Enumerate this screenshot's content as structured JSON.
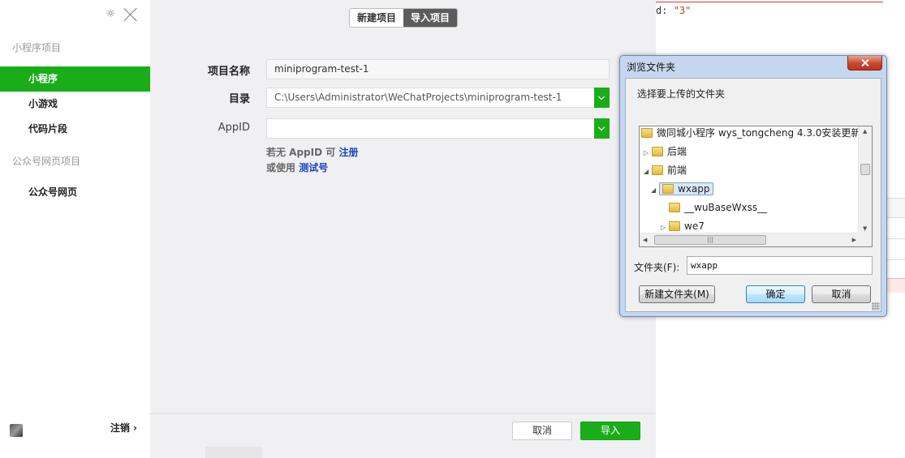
{
  "sidebar": {
    "section1_title": "小程序项目",
    "items": [
      {
        "label": "小程序",
        "active": true
      },
      {
        "label": "小游戏",
        "active": false
      },
      {
        "label": "代码片段",
        "active": false
      }
    ],
    "section2_title": "公众号网页项目",
    "item_webpage": "公众号网页",
    "logout_label": "注销 ›"
  },
  "tabs": {
    "new_project": "新建项目",
    "import_project": "导入项目"
  },
  "form": {
    "name_label": "项目名称",
    "name_value": "miniprogram-test-1",
    "dir_label": "目录",
    "dir_value": "C:\\Users\\Administrator\\WeChatProjects\\miniprogram-test-1",
    "appid_label": "AppID",
    "appid_value": "",
    "hint1_prefix": "若无 AppID 可",
    "hint1_link": "注册",
    "hint2_prefix": "或使用",
    "hint2_link": "测试号"
  },
  "footer": {
    "cancel": "取消",
    "import": "导入"
  },
  "code": {
    "key": "d: ",
    "value": "\"3\""
  },
  "dialog": {
    "title": "浏览文件夹",
    "description": "选择要上传的文件夹",
    "tree": [
      {
        "label": "微同城小程序 wys_tongcheng 4.3.0安装更新",
        "expander": ""
      },
      {
        "label": "后端",
        "expander": "▷"
      },
      {
        "label": "前端",
        "expander": "◢"
      },
      {
        "label": "wxapp",
        "expander": "◢",
        "selected": true
      },
      {
        "label": "__wuBaseWxss__",
        "expander": ""
      },
      {
        "label": "we7",
        "expander": "▷"
      }
    ],
    "folder_label": "文件夹(F):",
    "folder_value": "wxapp",
    "new_folder": "新建文件夹(M)",
    "ok": "确定",
    "cancel": "取消"
  },
  "colors": {
    "accent_green": "#1aad19",
    "link_blue": "#1a44c0"
  }
}
